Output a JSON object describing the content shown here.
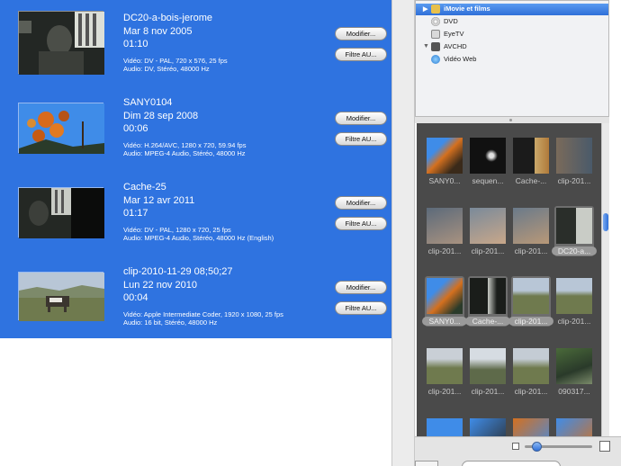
{
  "clips": [
    {
      "title": "DC20-a-bois-jerome",
      "date": "Mar 8 nov 2005",
      "duration": "01:10",
      "video": "Vidéo: DV - PAL, 720 x 576, 25 fps",
      "audio": "Audio: DV, Stéréo, 48000 Hz",
      "modify_label": "Modifier...",
      "filter_label": "Filtre AU..."
    },
    {
      "title": "SANY0104",
      "date": "Dim 28 sep 2008",
      "duration": "00:06",
      "video": "Vidéo: H.264/AVC, 1280 x 720, 59.94 fps",
      "audio": "Audio: MPEG-4 Audio, Stéréo, 48000 Hz",
      "modify_label": "Modifier...",
      "filter_label": "Filtre AU..."
    },
    {
      "title": "Cache-25",
      "date": "Mar 12 avr 2011",
      "duration": "01:17",
      "video": "Vidéo: DV - PAL, 1280 x 720, 25 fps",
      "audio": "Audio: MPEG-4 Audio, Stéréo, 48000 Hz (English)",
      "modify_label": "Modifier...",
      "filter_label": "Filtre AU..."
    },
    {
      "title": "clip-2010-11-29 08;50;27",
      "date": "Lun 22 nov 2010",
      "duration": "00:04",
      "video": "Vidéo: Apple Intermediate Coder, 1920 x 1080, 25 fps",
      "audio": "Audio: 16 bit, Stéréo, 48000 Hz",
      "modify_label": "Modifier...",
      "filter_label": "Filtre AU..."
    }
  ],
  "sources": [
    {
      "label": "iMovie et films",
      "selected": true,
      "icon": "film-icon"
    },
    {
      "label": "DVD",
      "selected": false,
      "icon": "dvd-icon"
    },
    {
      "label": "EyeTV",
      "selected": false,
      "icon": "eyetv-icon"
    },
    {
      "label": "AVCHD",
      "selected": false,
      "icon": "camera-icon"
    },
    {
      "label": "Vidéo Web",
      "selected": false,
      "icon": "globe-icon"
    }
  ],
  "grid_labels": [
    "SANY0...",
    "sequen...",
    "Cache-...",
    "clip-201...",
    "clip-201...",
    "clip-201...",
    "clip-201...",
    "DC20-a...",
    "SANY0...",
    "Cache-...",
    "clip-201...",
    "clip-201...",
    "clip-201...",
    "clip-201...",
    "clip-201...",
    "090317..."
  ],
  "colors": {
    "list_background": "#2f73e0",
    "grid_background": "#4a4a4a"
  }
}
